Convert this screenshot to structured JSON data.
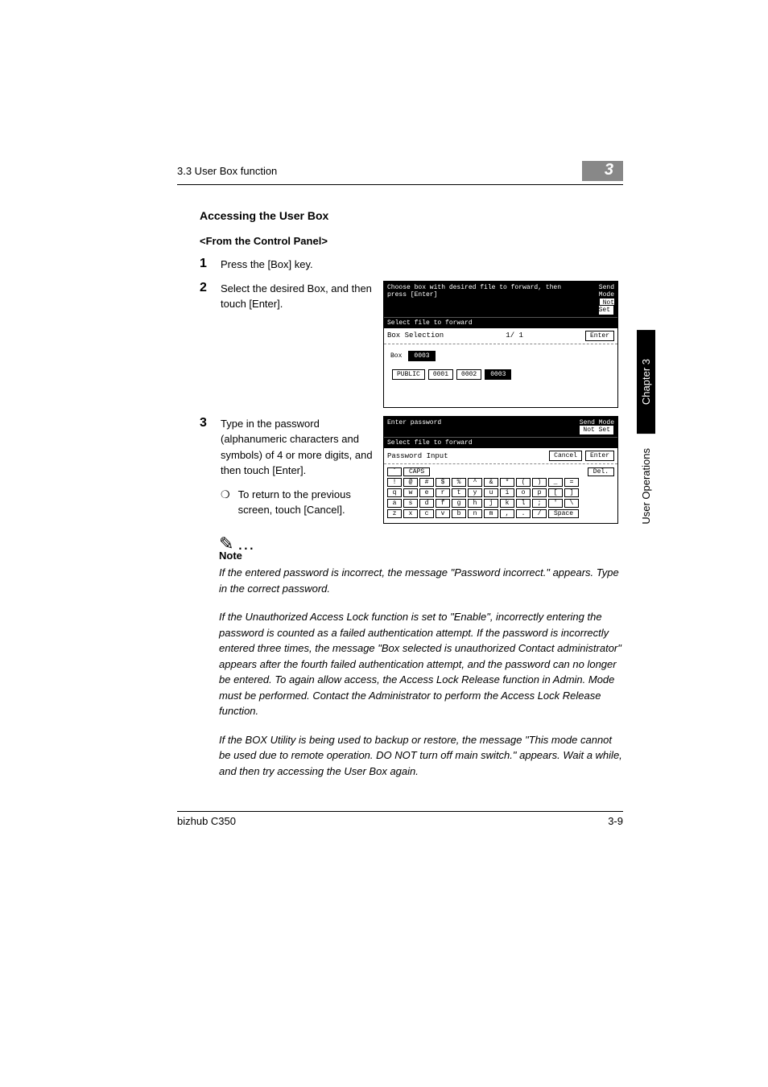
{
  "header": {
    "left": "3.3 User Box function",
    "right": "3"
  },
  "side": {
    "chapter": "Chapter 3",
    "user": "User Operations"
  },
  "headings": {
    "h1": "Accessing the User Box",
    "h2": "<From the Control Panel>"
  },
  "steps": {
    "s1": {
      "num": "1",
      "text": "Press the [Box] key."
    },
    "s2": {
      "num": "2",
      "text": "Select the desired Box, and then touch [Enter]."
    },
    "s3": {
      "num": "3",
      "text": "Type in the password (alphanumeric characters and symbols) of 4 or more digits, and then touch [Enter].",
      "bullet": "To return to the previous screen, touch [Cancel]."
    }
  },
  "screen1": {
    "title": "Choose box with desired file to forward, then press [Enter]",
    "mode_label": "Send Mode",
    "mode_value": "Not Set",
    "select": "Select file to forward",
    "bar_label": "Box Selection",
    "page": "1/  1",
    "enter": "Enter",
    "box_label": "Box",
    "box_num": "0003",
    "public": "PUBLIC",
    "b1": "0001",
    "b2": "0002",
    "b3": "0003"
  },
  "screen2": {
    "title": "Enter password",
    "mode_label": "Send Mode",
    "mode_value": "Not Set",
    "select": "Select file to forward",
    "bar_label": "Password Input",
    "cancel": "Cancel",
    "enter": "Enter",
    "caps": "CAPS",
    "del": "Del.",
    "space": "Space",
    "row1": [
      "!",
      "@",
      "#",
      "$",
      "%",
      "^",
      "&",
      "*",
      "(",
      ")",
      "_",
      "="
    ],
    "row2": [
      "q",
      "w",
      "e",
      "r",
      "t",
      "y",
      "u",
      "i",
      "o",
      "p",
      "[",
      "]"
    ],
    "row3": [
      "a",
      "s",
      "d",
      "f",
      "g",
      "h",
      "j",
      "k",
      "l",
      ";",
      "'",
      "\\"
    ],
    "row4": [
      "z",
      "x",
      "c",
      "v",
      "b",
      "n",
      "m",
      ",",
      ".",
      "/"
    ]
  },
  "note": {
    "icon": "✎…",
    "label": "Note",
    "p1": "If the entered password is incorrect, the message \"Password incorrect.\" appears. Type in the correct password.",
    "p2": "If the Unauthorized Access Lock function is set to \"Enable\", incorrectly entering the password is counted as a failed authentication attempt. If the password is incorrectly entered three times, the message \"Box selected is unauthorized Contact administrator\" appears after the fourth failed authentication attempt, and the password can no longer be entered. To again allow access, the Access Lock Release function in Admin. Mode must be performed. Contact the Administrator to perform the Access Lock Release function.",
    "p3": "If the BOX Utility is being used to backup or restore, the message \"This mode cannot be used due to remote operation. DO NOT turn off main switch.\" appears. Wait a while, and then try accessing the User Box again."
  },
  "footer": {
    "left": "bizhub C350",
    "right": "3-9"
  }
}
